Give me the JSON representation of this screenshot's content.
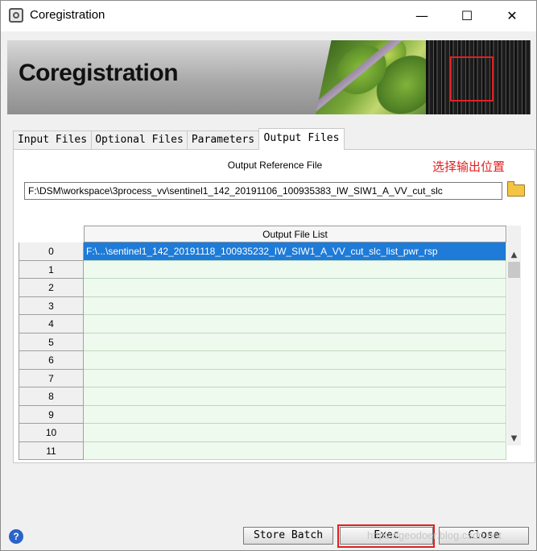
{
  "window": {
    "title": "Coregistration",
    "minimize": "—",
    "maximize": "☐",
    "close": "✕"
  },
  "banner": {
    "title": "Coregistration"
  },
  "tabs": [
    {
      "label": "Input Files"
    },
    {
      "label": "Optional Files"
    },
    {
      "label": "Parameters"
    },
    {
      "label": "Output Files",
      "active": true
    }
  ],
  "output_panel": {
    "reference_label": "Output Reference File",
    "annotation": "选择输出位置",
    "reference_path": "F:\\DSM\\workspace\\3process_vv\\sentinel1_142_20191106_100935383_IW_SIW1_A_VV_cut_slc",
    "file_list_header": "Output File List",
    "rows": [
      {
        "index": "0",
        "value": "F:\\...\\sentinel1_142_20191118_100935232_IW_SIW1_A_VV_cut_slc_list_pwr_rsp",
        "selected": true
      },
      {
        "index": "1",
        "value": ""
      },
      {
        "index": "2",
        "value": ""
      },
      {
        "index": "3",
        "value": ""
      },
      {
        "index": "4",
        "value": ""
      },
      {
        "index": "5",
        "value": ""
      },
      {
        "index": "6",
        "value": ""
      },
      {
        "index": "7",
        "value": ""
      },
      {
        "index": "8",
        "value": ""
      },
      {
        "index": "9",
        "value": ""
      },
      {
        "index": "10",
        "value": ""
      },
      {
        "index": "11",
        "value": ""
      }
    ]
  },
  "buttons": {
    "store_batch": "Store Batch",
    "exec": "Exec",
    "close": "Close"
  },
  "watermark": "https://geodoer.blog.csdn.net",
  "colors": {
    "selection": "#1e7bd8",
    "row_fill": "#edfaed",
    "annotation": "#e02020"
  }
}
